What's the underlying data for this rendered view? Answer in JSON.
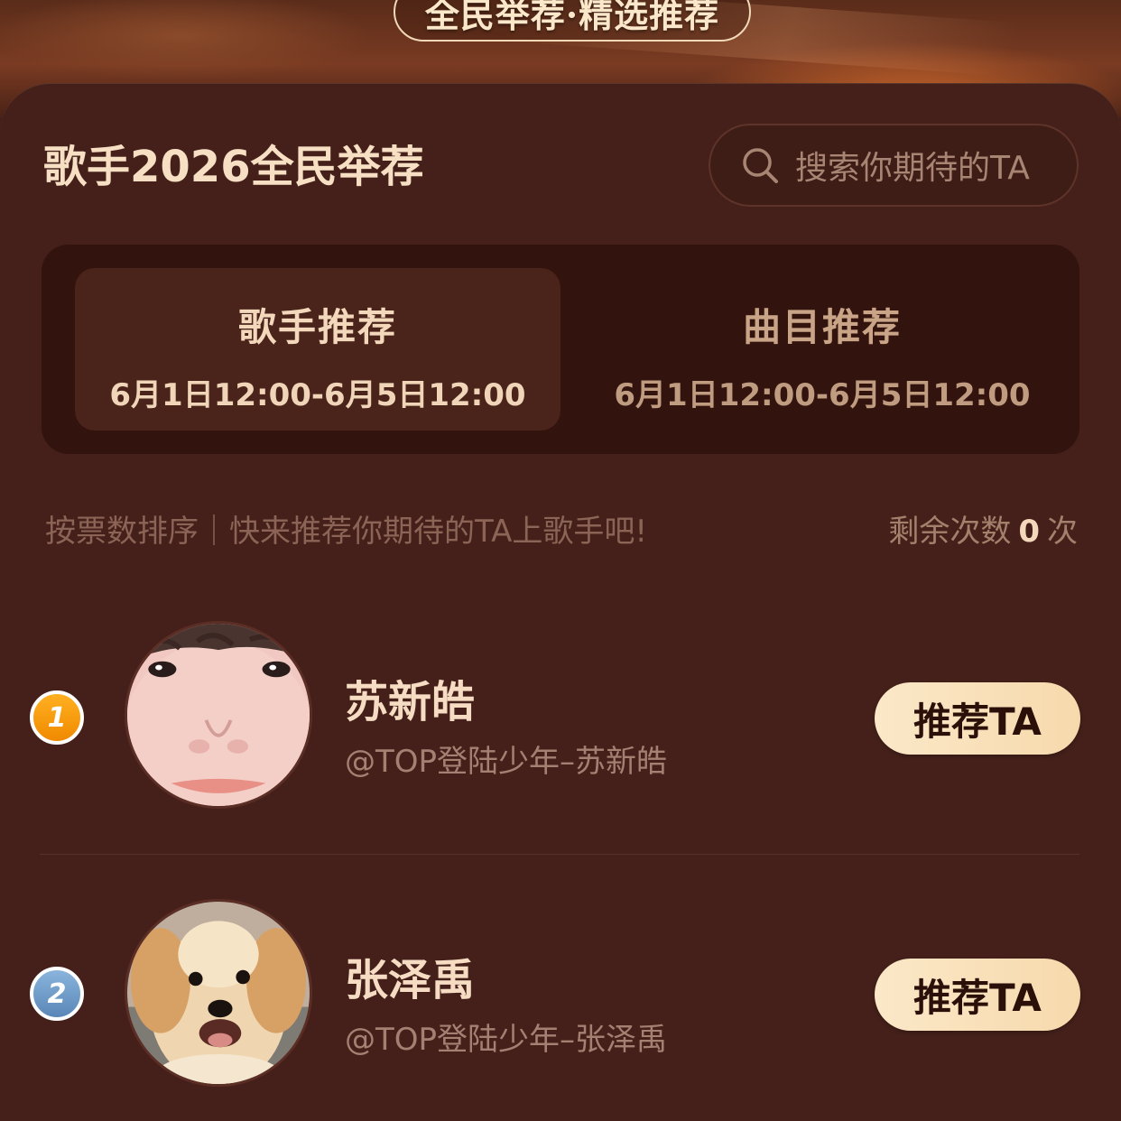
{
  "banner": {
    "title": "全民举荐·精选推荐"
  },
  "header": {
    "title": "歌手2026全民举荐"
  },
  "search": {
    "placeholder": "搜索你期待的TA",
    "icon": "search-icon"
  },
  "tabs": [
    {
      "label": "歌手推荐",
      "period": "6月1日12:00-6月5日12:00",
      "active": true
    },
    {
      "label": "曲目推荐",
      "period": "6月1日12:00-6月5日12:00",
      "active": false
    }
  ],
  "info": {
    "sort_note": "按票数排序｜快来推荐你期待的TA上歌手吧!",
    "remaining_prefix": "剩余次数",
    "remaining_count": "0",
    "remaining_suffix": "次"
  },
  "singers": [
    {
      "rank": "1",
      "name": "苏新皓",
      "handle": "@TOP登陆少年–苏新皓",
      "button": "推荐TA"
    },
    {
      "rank": "2",
      "name": "张泽禹",
      "handle": "@TOP登陆少年–张泽禹",
      "button": "推荐TA"
    }
  ],
  "colors": {
    "background": "#45201a",
    "button": "#f9e0b8",
    "rank_gold": "#f59a0c",
    "rank_silver": "#6f9bc8"
  }
}
